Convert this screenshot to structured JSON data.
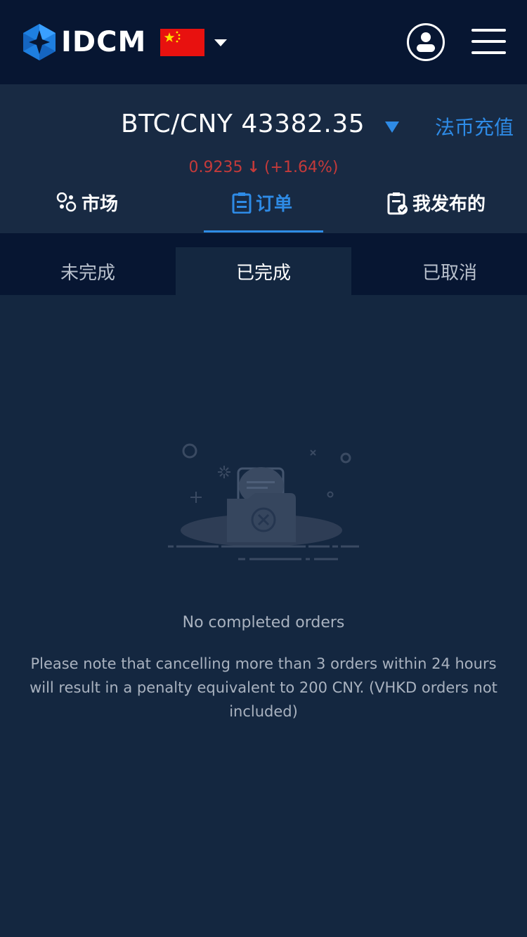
{
  "brand": {
    "name": "IDCM"
  },
  "topbar": {
    "flag_icon": "china-flag-icon",
    "dropdown_icon": "caret-down-icon",
    "user_icon": "user-icon",
    "menu_icon": "hamburger-menu-icon"
  },
  "ticker": {
    "pair": "BTC/CNY",
    "price": "43382.35",
    "deposit_label": "法币充值",
    "rate": "0.9235",
    "change": "(+1.64%)",
    "colors": {
      "accent": "#2e8be6",
      "down": "#c43a3a"
    }
  },
  "main_tabs": [
    {
      "label": "市场",
      "icon": "market-icon",
      "active": false
    },
    {
      "label": "订单",
      "icon": "orders-icon",
      "active": true
    },
    {
      "label": "我发布的",
      "icon": "my-posts-icon",
      "active": false
    }
  ],
  "sub_tabs": [
    {
      "label": "未完成",
      "active": false
    },
    {
      "label": "已完成",
      "active": true
    },
    {
      "label": "已取消",
      "active": false
    }
  ],
  "empty_state": {
    "icon": "empty-box-illustration",
    "title": "No completed orders",
    "note": "Please note that cancelling more than 3 orders within 24 hours will result in a penalty equivalent to 200 CNY. (VHKD orders not included)"
  }
}
